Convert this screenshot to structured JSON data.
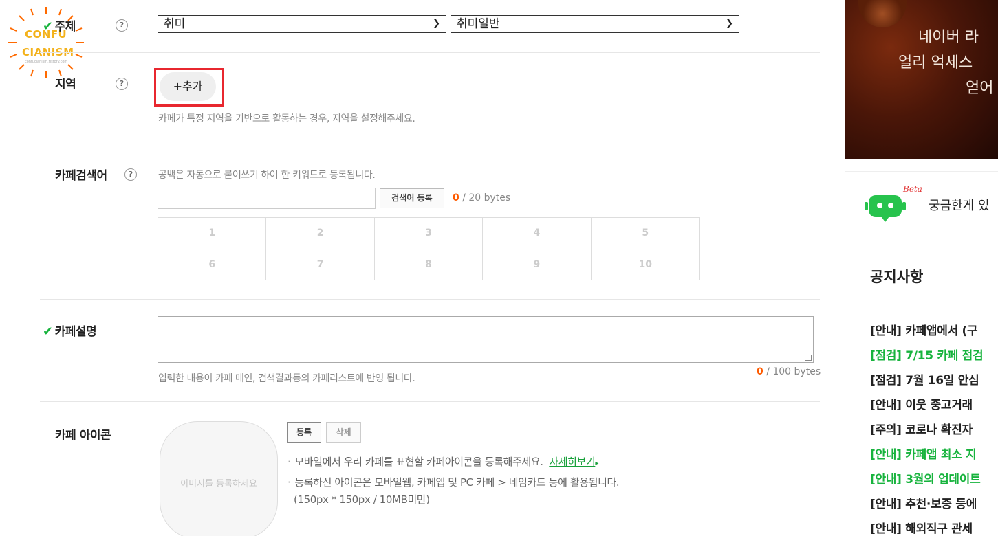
{
  "logo": {
    "line1": "CONFU",
    "line2": "CIANISM",
    "url_text": "confucianism.tistory.com"
  },
  "topic": {
    "label": "주제",
    "primary_select": "취미",
    "secondary_select": "취미일반",
    "help": "?"
  },
  "region": {
    "label": "지역",
    "help": "?",
    "add_button": "+추가",
    "hint": "카페가 특정 지역을 기반으로 활동하는 경우, 지역을 설정해주세요."
  },
  "keyword": {
    "label": "카페검색어",
    "help": "?",
    "hint": "공백은 자동으로 붙여쓰기 하여 한 키워드로 등록됩니다.",
    "input_value": "",
    "register_button": "검색어 등록",
    "bytes_count": "0",
    "bytes_limit": " / 20 bytes",
    "slots": [
      "1",
      "2",
      "3",
      "4",
      "5",
      "6",
      "7",
      "8",
      "9",
      "10"
    ]
  },
  "description": {
    "label": "카페설명",
    "value": "",
    "bytes_count": "0",
    "bytes_limit": " / 100 bytes",
    "hint": "입력한 내용이 카페 메인, 검색결과등의 카페리스트에 반영 됩니다."
  },
  "cafe_icon": {
    "label": "카페 아이콘",
    "placeholder": "이미지를 등록하세요",
    "register_button": "등록",
    "delete_button": "삭제",
    "bullet1": "모바일에서 우리 카페를 표현할 카페아이콘을 등록해주세요.",
    "bullet1_link": "자세히보기",
    "bullet2": "등록하신 아이콘은 모바일웹, 카페앱 및 PC 카페 > 네임카드 등에 활용됩니다.",
    "bullet2_sub": "(150px * 150px / 10MB미만)"
  },
  "sidebar": {
    "ad_lines": [
      "네이버 라",
      "얼리 억세스",
      "얻어"
    ],
    "bot_badge": "Beta",
    "bot_text": "궁금한게 있",
    "notice_title": "공지사항",
    "notices": [
      {
        "text": "[안내] 카페앱에서 (구",
        "color": "#222222"
      },
      {
        "text": "[점검] 7/15 카페 점검",
        "color": "#17b33d"
      },
      {
        "text": "[점검] 7월 16일 안심",
        "color": "#222222"
      },
      {
        "text": "[안내] 이웃 중고거래",
        "color": "#222222"
      },
      {
        "text": "[주의] 코로나 확진자",
        "color": "#222222"
      },
      {
        "text": "[안내] 카페앱 최소 지",
        "color": "#17b33d"
      },
      {
        "text": "[안내] 3월의 업데이트",
        "color": "#17b33d"
      },
      {
        "text": "[안내] 추천·보증 등에",
        "color": "#222222"
      },
      {
        "text": "[안내] 해외직구 관세",
        "color": "#222222"
      }
    ]
  },
  "colors": {
    "accent_green": "#17b33d",
    "highlight_red": "#e8272f",
    "bytes_orange": "#ff5b00"
  }
}
